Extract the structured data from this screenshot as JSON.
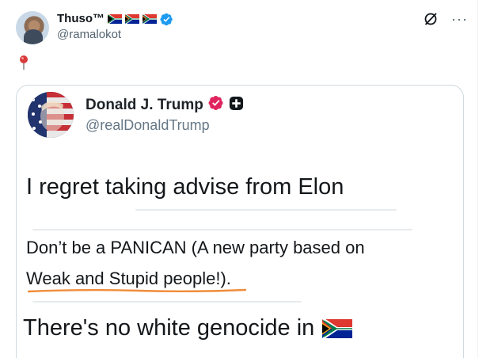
{
  "tweet": {
    "author": {
      "display_name": "Thuso™",
      "handle": "@ramalokot",
      "flags": [
        "south-africa-flag",
        "south-africa-flag",
        "south-africa-flag"
      ],
      "verified": true
    },
    "body_emoji": "round-pushpin",
    "icons": [
      "grok-icon",
      "more-icon"
    ],
    "more_label": "···"
  },
  "embedded_screenshot": {
    "author": {
      "display_name": "Donald J. Trump",
      "handle": "@realDonaldTrump",
      "badges": [
        "verified-badge",
        "affiliate-badge"
      ]
    },
    "lines": {
      "line1": "I regret taking advise from Elon",
      "line2": "Don’t be a PANICAN (A new party based on",
      "line3": "Weak and Stupid people!).",
      "line4": "There's no white genocide in"
    },
    "line4_flag": "south-africa-flag",
    "colors": {
      "verified_blue": "#1d9bf0",
      "trump_badge_pink": "#e0245e",
      "underline_orange": "#f08c3a"
    }
  }
}
